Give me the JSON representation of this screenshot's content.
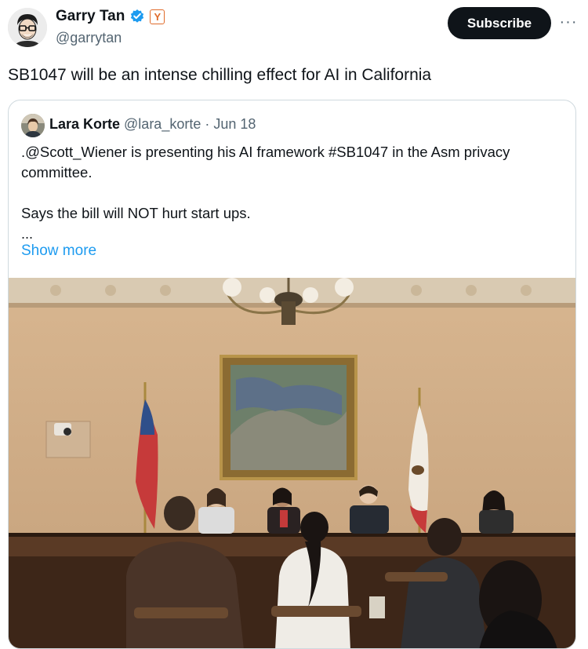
{
  "author": {
    "display_name": "Garry Tan",
    "handle": "@garrytan",
    "badge_text": "Y",
    "avatar_icon": "avatar-illustration"
  },
  "subscribe_label": "Subscribe",
  "more_label": "···",
  "tweet_text": "SB1047 will be an intense chilling effect for AI in California",
  "quote": {
    "display_name": "Lara Korte",
    "handle": "@lara_korte",
    "separator": "·",
    "date": "Jun 18",
    "line1": ".@Scott_Wiener is presenting his AI framework #SB1047 in the Asm privacy committee.",
    "line2": "Says the bill will NOT hurt start ups.",
    "ellipsis": "...",
    "show_more": "Show more"
  },
  "colors": {
    "accent": "#1d9bf0",
    "verified": "#1d9bf0",
    "yc_orange": "#e06b2a",
    "button_bg": "#0f1419"
  }
}
